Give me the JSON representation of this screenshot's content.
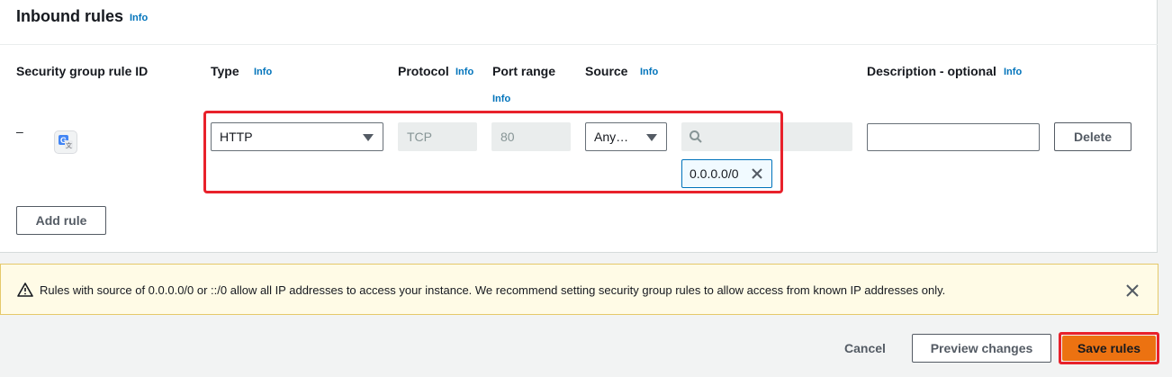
{
  "panel": {
    "title": "Inbound rules",
    "title_info": "Info"
  },
  "columns": {
    "rule_id": "Security group rule ID",
    "type": "Type",
    "type_info": "Info",
    "protocol": "Protocol",
    "protocol_info": "Info",
    "port_range": "Port range",
    "port_range_info": "Info",
    "source": "Source",
    "source_info": "Info",
    "description": "Description - optional",
    "description_info": "Info"
  },
  "rule": {
    "rule_id": "–",
    "type_value": "HTTP",
    "protocol_value": "TCP",
    "port_value": "80",
    "source_value": "Any…",
    "source_search_value": "",
    "source_token": "0.0.0.0/0",
    "description_value": "",
    "delete_label": "Delete"
  },
  "add_rule_label": "Add rule",
  "warning": {
    "text": "Rules with source of 0.0.0.0/0 or ::/0 allow all IP addresses to access your instance. We recommend setting security group rules to allow access from known IP addresses only."
  },
  "footer": {
    "cancel_label": "Cancel",
    "preview_label": "Preview changes",
    "save_label": "Save rules"
  },
  "colors": {
    "accent": "#0073bb",
    "primary": "#ec7211",
    "highlight": "#e8212b",
    "warning_bg": "#fffbe6"
  },
  "icons": [
    "translate-icon",
    "caret-down-icon",
    "search-icon",
    "close-icon",
    "warning-icon"
  ]
}
